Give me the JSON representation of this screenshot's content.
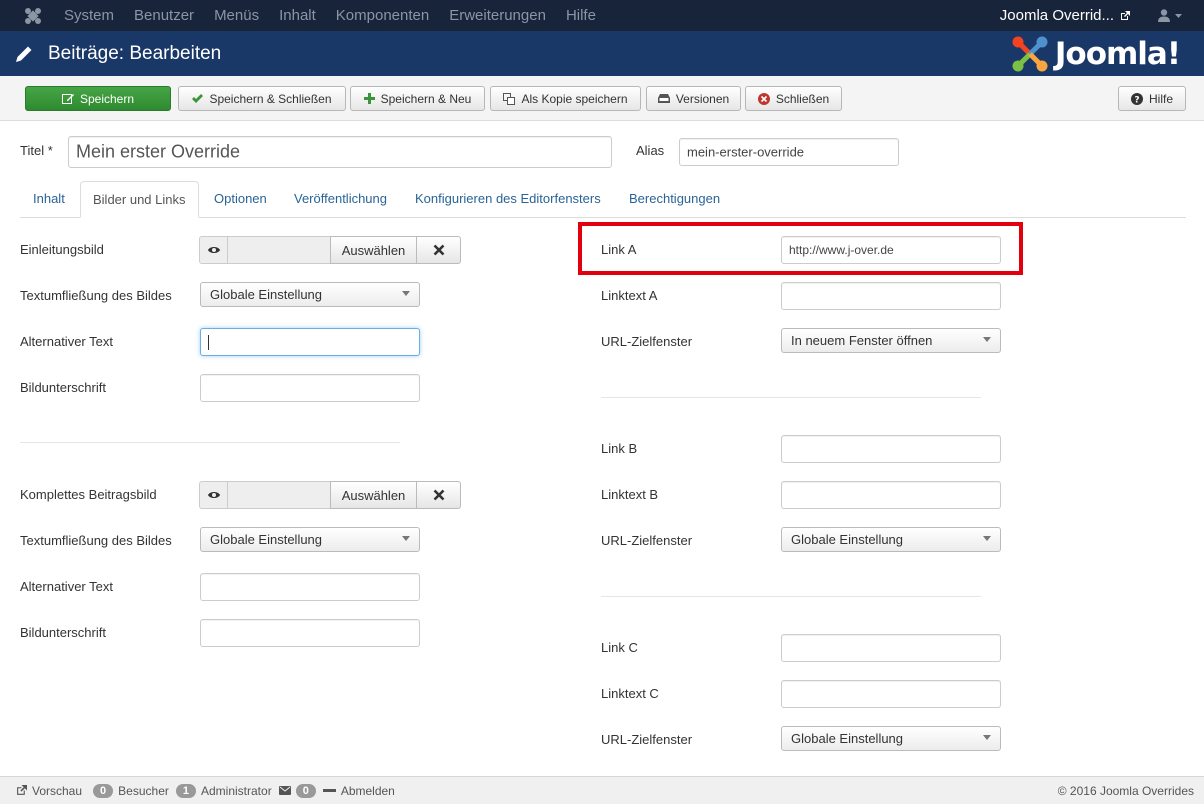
{
  "topnav": {
    "menu": [
      "System",
      "Benutzer",
      "Menüs",
      "Inhalt",
      "Komponenten",
      "Erweiterungen",
      "Hilfe"
    ],
    "site_name": "Joomla Overrid..."
  },
  "header": {
    "title": "Beiträge: Bearbeiten",
    "logo_text": "Joomla!"
  },
  "toolbar": {
    "save": "Speichern",
    "save_close": "Speichern & Schließen",
    "save_new": "Speichern & Neu",
    "save_copy": "Als Kopie speichern",
    "versions": "Versionen",
    "close": "Schließen",
    "help": "Hilfe"
  },
  "form": {
    "title_label": "Titel *",
    "title_value": "Mein erster Override",
    "alias_label": "Alias",
    "alias_value": "mein-erster-override"
  },
  "tabs": [
    "Inhalt",
    "Bilder und Links",
    "Optionen",
    "Veröffentlichung",
    "Konfigurieren des Editorfensters",
    "Berechtigungen"
  ],
  "images": {
    "intro_label": "Einleitungsbild",
    "select_button": "Auswählen",
    "float_label": "Textumfließung des Bildes",
    "float_value": "Globale Einstellung",
    "alt_label": "Alternativer Text",
    "caption_label": "Bildunterschrift",
    "full_label": "Komplettes Beitragsbild"
  },
  "links": {
    "link_a_label": "Link A",
    "link_a_value": "http://www.j-over.de",
    "linktext_a_label": "Linktext A",
    "target_label": "URL-Zielfenster",
    "target_a_value": "In neuem Fenster öffnen",
    "link_b_label": "Link B",
    "linktext_b_label": "Linktext B",
    "target_b_value": "Globale Einstellung",
    "link_c_label": "Link C",
    "linktext_c_label": "Linktext C",
    "target_c_value": "Globale Einstellung"
  },
  "footer": {
    "preview": "Vorschau",
    "visitors_count": "0",
    "visitors": "Besucher",
    "admin_count": "1",
    "admin": "Administrator",
    "messages_count": "0",
    "logout": "Abmelden",
    "copyright": "© 2016 Joomla Overrides"
  },
  "colors": {
    "navbar": "#17243a",
    "header": "#1a3867",
    "save_green": "#3a953a",
    "highlight": "#e2000f"
  }
}
